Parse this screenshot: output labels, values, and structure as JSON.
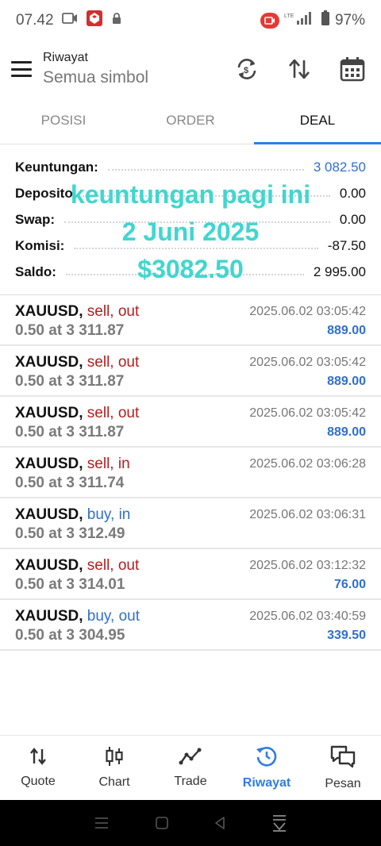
{
  "status_bar": {
    "time": "07.42",
    "battery": "97%",
    "network": "LTE"
  },
  "header": {
    "title": "Riwayat",
    "subtitle": "Semua simbol"
  },
  "tabs": [
    {
      "label": "POSISI",
      "active": false
    },
    {
      "label": "ORDER",
      "active": false
    },
    {
      "label": "DEAL",
      "active": true
    }
  ],
  "summary": {
    "keuntungan": {
      "label": "Keuntungan:",
      "value": "3 082.50"
    },
    "deposit": {
      "label": "Deposito",
      "value": "0.00"
    },
    "swap": {
      "label": "Swap:",
      "value": "0.00"
    },
    "komisi": {
      "label": "Komisi:",
      "value": "-87.50"
    },
    "saldo": {
      "label": "Saldo:",
      "value": "2 995.00"
    }
  },
  "overlay": {
    "line1": "keuntungan pagi ini",
    "line2": "2 Juni 2025",
    "line3": "$3082.50"
  },
  "deals": [
    {
      "symbol": "XAUUSD",
      "sep": ",",
      "side": "sell, out",
      "side_type": "sell",
      "detail": "0.50 at 3 311.87",
      "time": "2025.06.02 03:05:42",
      "profit": "889.00"
    },
    {
      "symbol": "XAUUSD",
      "sep": ",",
      "side": "sell, out",
      "side_type": "sell",
      "detail": "0.50 at 3 311.87",
      "time": "2025.06.02 03:05:42",
      "profit": "889.00"
    },
    {
      "symbol": "XAUUSD",
      "sep": ",",
      "side": "sell, out",
      "side_type": "sell",
      "detail": "0.50 at 3 311.87",
      "time": "2025.06.02 03:05:42",
      "profit": "889.00"
    },
    {
      "symbol": "XAUUSD",
      "sep": ",",
      "side": "sell, in",
      "side_type": "sell",
      "detail": "0.50 at 3 311.74",
      "time": "2025.06.02 03:06:28",
      "profit": ""
    },
    {
      "symbol": "XAUUSD",
      "sep": ",",
      "side": "buy, in",
      "side_type": "buy",
      "detail": "0.50 at 3 312.49",
      "time": "2025.06.02 03:06:31",
      "profit": ""
    },
    {
      "symbol": "XAUUSD",
      "sep": ",",
      "side": "sell, out",
      "side_type": "sell",
      "detail": "0.50 at 3 314.01",
      "time": "2025.06.02 03:12:32",
      "profit": "76.00"
    },
    {
      "symbol": "XAUUSD",
      "sep": ",",
      "side": "buy, out",
      "side_type": "buy",
      "detail": "0.50 at 3 304.95",
      "time": "2025.06.02 03:40:59",
      "profit": "339.50"
    }
  ],
  "bottom_nav": [
    {
      "label": "Quote",
      "icon": "quote-icon",
      "active": false
    },
    {
      "label": "Chart",
      "icon": "chart-icon",
      "active": false
    },
    {
      "label": "Trade",
      "icon": "trade-icon",
      "active": false
    },
    {
      "label": "Riwayat",
      "icon": "history-icon",
      "active": true
    },
    {
      "label": "Pesan",
      "icon": "messages-icon",
      "active": false
    }
  ],
  "colors": {
    "accent": "#2f7de1",
    "profit_blue": "#2f6fcf",
    "sell_red": "#b71c1c",
    "overlay_cyan": "#3fd7cf"
  }
}
